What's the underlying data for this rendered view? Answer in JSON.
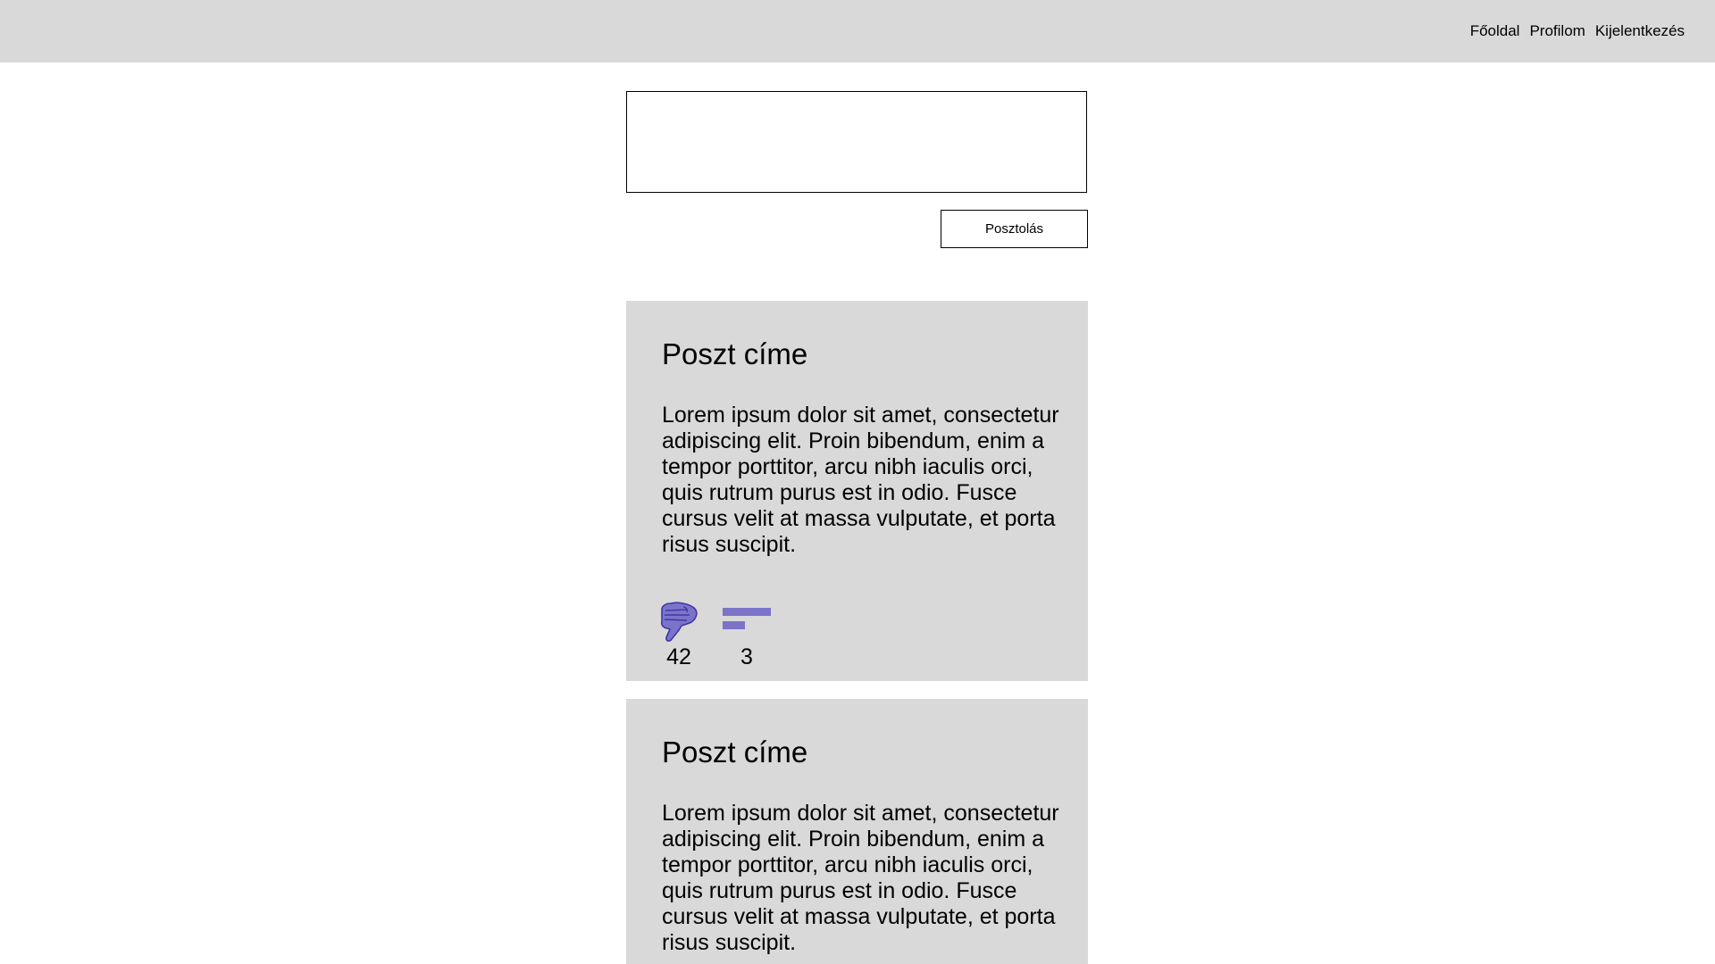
{
  "nav": {
    "items": [
      "Főoldal",
      "Profilom",
      "Kijelentkezés"
    ]
  },
  "composer": {
    "value": "",
    "placeholder": "",
    "submit_label": "Posztolás"
  },
  "posts": [
    {
      "title": "Poszt címe",
      "body": "Lorem ipsum dolor sit amet, consectetur adipiscing elit. Proin bibendum, enim a tempor porttitor, arcu nibh iaculis orci, quis rutrum purus est in odio. Fusce cursus velit at massa vulputate, et porta risus suscipit.",
      "dislikes": "42",
      "comments": "3"
    },
    {
      "title": "Poszt címe",
      "body": "Lorem ipsum dolor sit amet, consectetur adipiscing elit. Proin bibendum, enim a tempor porttitor, arcu nibh iaculis orci, quis rutrum purus est in odio. Fusce cursus velit at massa vulputate, et porta risus suscipit."
    }
  ],
  "icons": {
    "dislike": "thumbs-down-icon",
    "comments": "comment-lines-icon"
  },
  "colors": {
    "topbar": "#d9d9d9",
    "card": "#d9d9d9",
    "icon_fill": "#7b74c9",
    "icon_stroke": "#3f36a8"
  }
}
